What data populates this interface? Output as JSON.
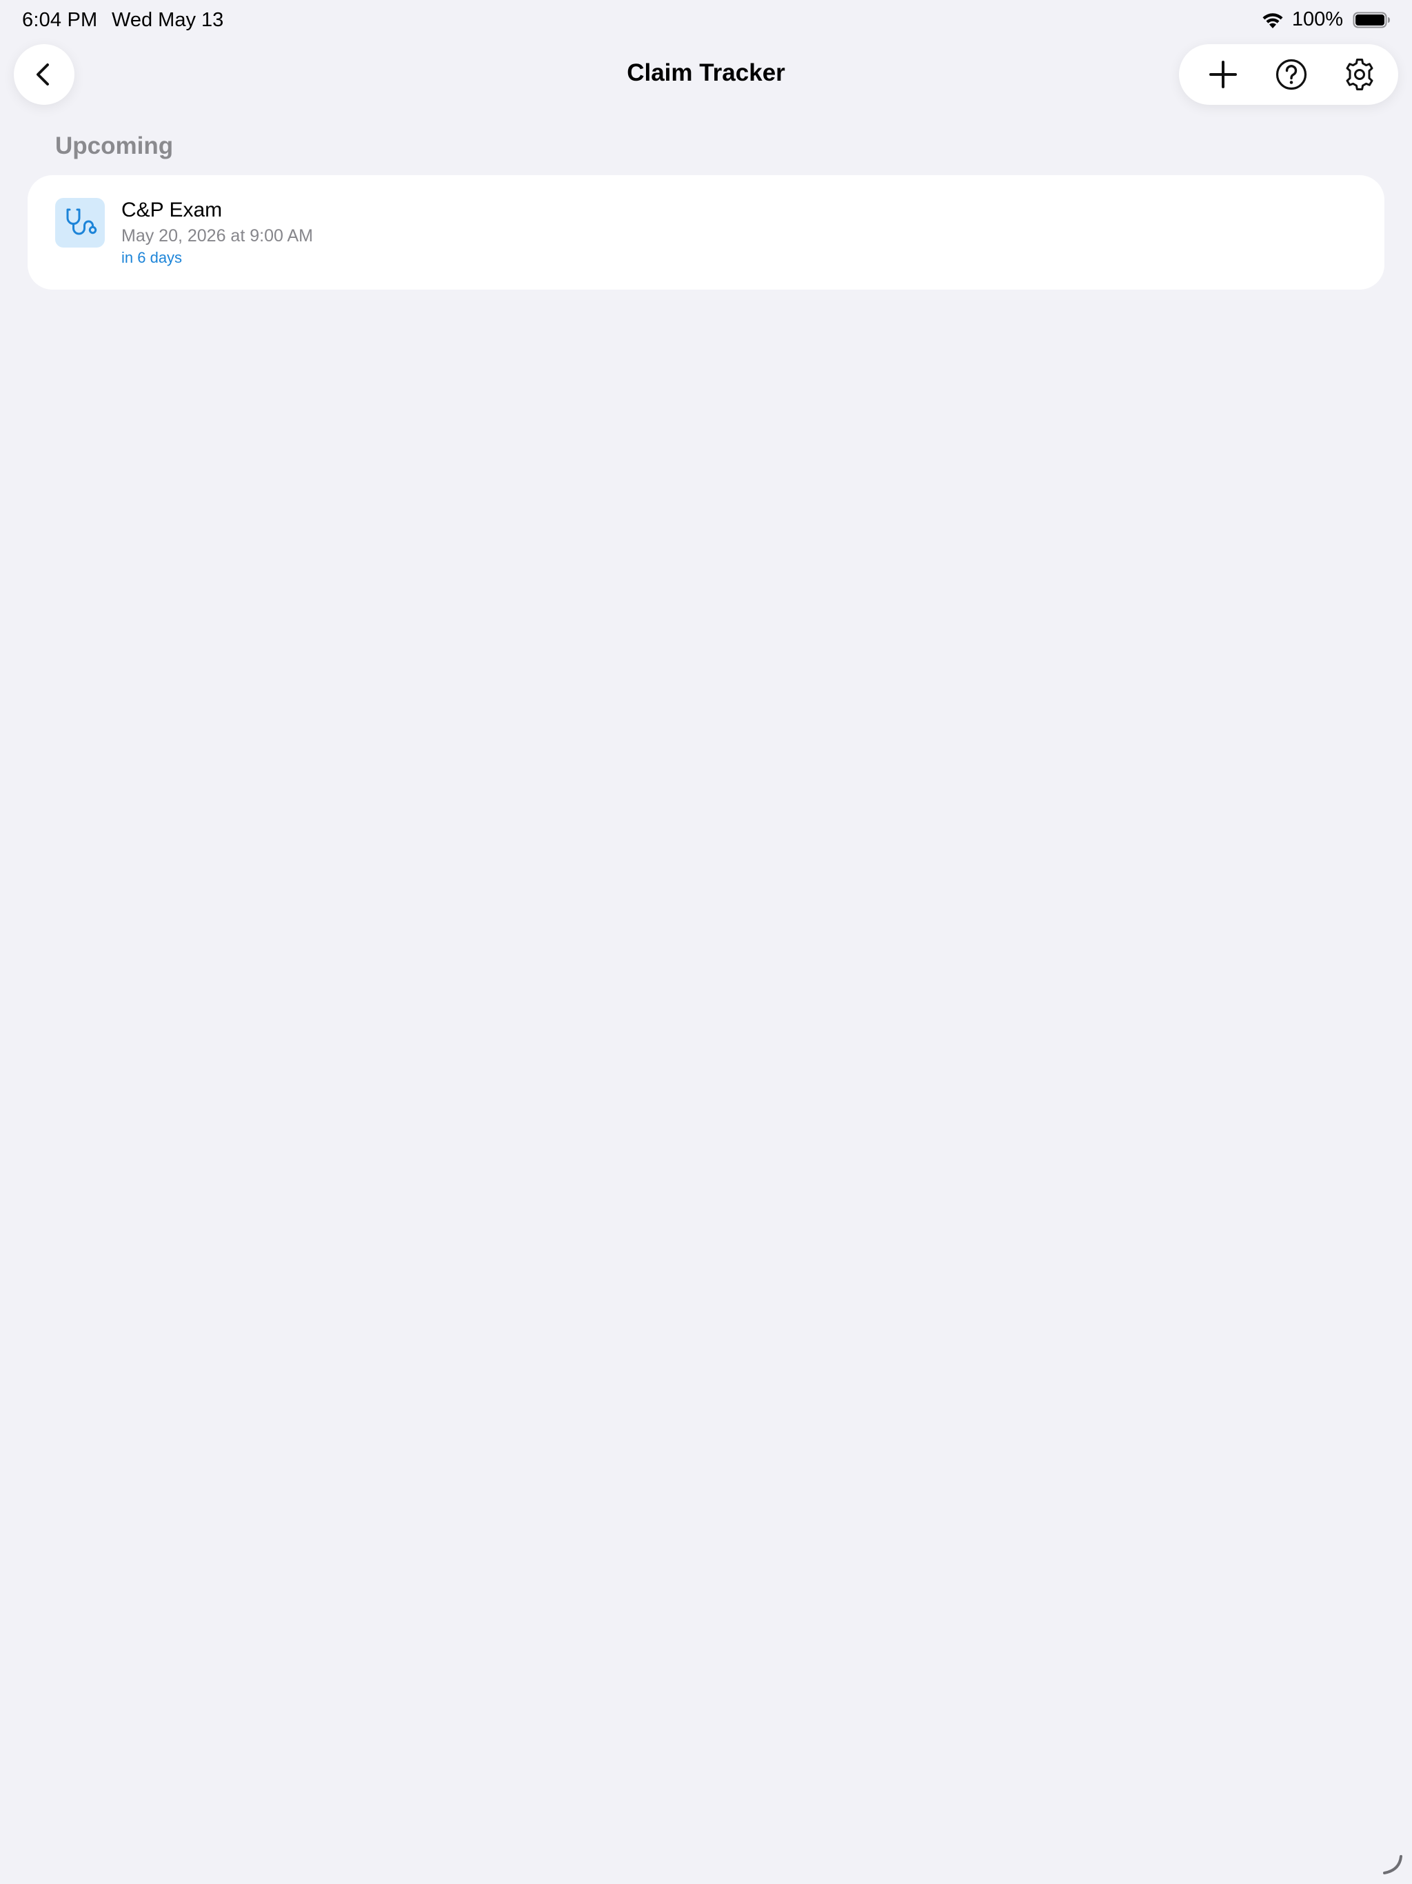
{
  "status_bar": {
    "time": "6:04 PM",
    "date": "Wed May 13",
    "battery_percent": "100%",
    "wifi_icon": "wifi-icon",
    "battery_icon": "battery-icon"
  },
  "nav": {
    "title": "Claim Tracker",
    "back_icon": "chevron-left-icon",
    "toolbar_icons": [
      "plus-icon",
      "question-circle-icon",
      "gear-icon"
    ]
  },
  "section": {
    "header": "Upcoming"
  },
  "upcoming_items": [
    {
      "icon": "stethoscope-icon",
      "title": "C&P Exam",
      "datetime": "May 20, 2026 at 9:00 AM",
      "countdown": "in 6 days"
    }
  ],
  "colors": {
    "background": "#f2f2f7",
    "card": "#ffffff",
    "accent": "#1c84d8",
    "icon_tile": "#d4eafb",
    "secondary_text": "#86868b",
    "section_header": "#8a8a8e"
  }
}
